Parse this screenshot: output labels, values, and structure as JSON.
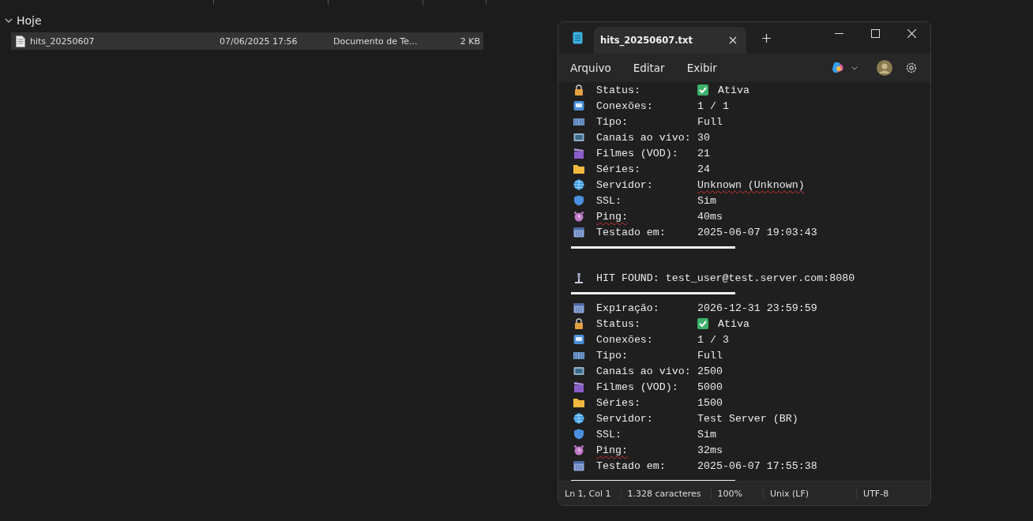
{
  "explorer": {
    "group": {
      "label": "Hoje",
      "expanded": true
    },
    "files": [
      {
        "name": "hits_20250607",
        "modified": "07/06/2025 17:56",
        "type": "Documento de Te...",
        "size": "2 KB",
        "selected": true
      }
    ]
  },
  "notepad": {
    "tabs": [
      {
        "title": "hits_20250607.txt",
        "selected": true
      }
    ],
    "menu": [
      "Arquivo",
      "Editar",
      "Exibir"
    ],
    "lines": [
      {
        "kind": "field",
        "label": "Status:",
        "value": "Ativa",
        "checked": true
      },
      {
        "kind": "field",
        "label": "Conexões:",
        "value": "1 / 1"
      },
      {
        "kind": "field",
        "label": "Tipo:",
        "value": "Full"
      },
      {
        "kind": "field",
        "label": "Canais ao vivo:",
        "value": "30"
      },
      {
        "kind": "field",
        "label": "Filmes (VOD):",
        "value": "21"
      },
      {
        "kind": "field",
        "label": "Séries:",
        "value": "24"
      },
      {
        "kind": "field",
        "label": "Servidor:",
        "value": "Unknown (Unknown)",
        "value_misspelled": true
      },
      {
        "kind": "field",
        "label": "SSL:",
        "value": "Sim"
      },
      {
        "kind": "field",
        "label": "Ping:",
        "value": "40ms",
        "label_misspelled": true
      },
      {
        "kind": "field",
        "label": "Testado em:",
        "value": "2025-06-07 19:03:43"
      },
      {
        "kind": "rule"
      },
      {
        "kind": "blank"
      },
      {
        "kind": "heading",
        "text": "HIT FOUND: test_user@test.server.com:8080"
      },
      {
        "kind": "rule"
      },
      {
        "kind": "field",
        "label": "Expiração:",
        "value": "2026-12-31 23:59:59"
      },
      {
        "kind": "field",
        "label": "Status:",
        "value": "Ativa",
        "checked": true
      },
      {
        "kind": "field",
        "label": "Conexões:",
        "value": "1 / 3"
      },
      {
        "kind": "field",
        "label": "Tipo:",
        "value": "Full"
      },
      {
        "kind": "field",
        "label": "Canais ao vivo:",
        "value": "2500"
      },
      {
        "kind": "field",
        "label": "Filmes (VOD):",
        "value": "5000"
      },
      {
        "kind": "field",
        "label": "Séries:",
        "value": "1500"
      },
      {
        "kind": "field",
        "label": "Servidor:",
        "value": "Test Server (BR)"
      },
      {
        "kind": "field",
        "label": "SSL:",
        "value": "Sim"
      },
      {
        "kind": "field",
        "label": "Ping:",
        "value": "32ms",
        "label_misspelled": true
      },
      {
        "kind": "field",
        "label": "Testado em:",
        "value": "2025-06-07 17:55:38"
      },
      {
        "kind": "rule"
      }
    ],
    "status_bar": [
      "Ln 1, Col 1",
      "1.328 caracteres",
      "100%",
      "Unix (LF)",
      "UTF-8"
    ]
  }
}
